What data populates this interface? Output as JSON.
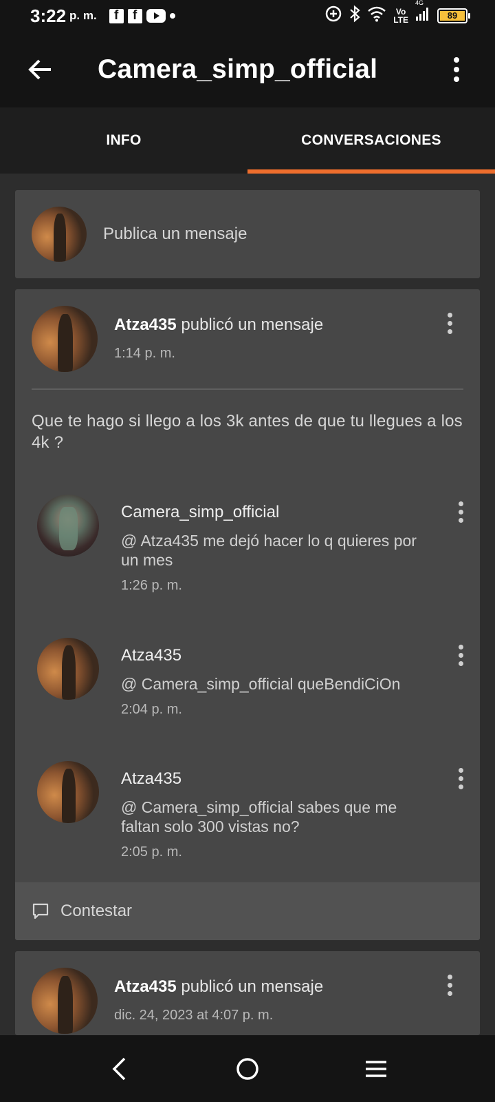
{
  "status_bar": {
    "time": "3:22",
    "ampm": "p. m.",
    "battery": "89",
    "network": "4G",
    "volte_top": "Vo",
    "volte_bottom": "LTE"
  },
  "app_bar": {
    "title": "Camera_simp_official"
  },
  "tabs": [
    {
      "label": "INFO",
      "active": false
    },
    {
      "label": "CONVERSACIONES",
      "active": true
    }
  ],
  "accent_color": "#ee6e2d",
  "composer": {
    "placeholder": "Publica un mensaje"
  },
  "threads": [
    {
      "author": "Atza435",
      "action": "publicó un mensaje",
      "time": "1:14 p. m.",
      "body": "Que te hago si llego a los 3k antes de que tu llegues a los 4k ?",
      "replies": [
        {
          "user": "Camera_simp_official",
          "message": "@ Atza435  me dejó hacer lo q quieres por un mes",
          "time": "1:26 p. m."
        },
        {
          "user": "Atza435",
          "message": "@ Camera_simp_official  queBendiCiOn",
          "time": "2:04 p. m."
        },
        {
          "user": "Atza435",
          "message": "@ Camera_simp_official  sabes que me faltan solo 300 vistas no?",
          "time": "2:05 p. m."
        }
      ],
      "reply_label": "Contestar"
    },
    {
      "author": "Atza435",
      "action": "publicó un mensaje",
      "time": "dic. 24, 2023 at 4:07 p. m."
    }
  ]
}
